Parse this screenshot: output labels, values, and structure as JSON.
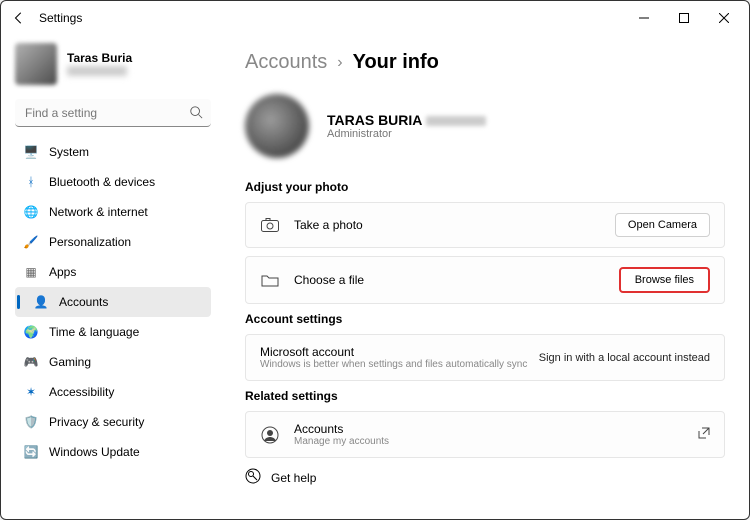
{
  "window": {
    "title": "Settings"
  },
  "user": {
    "name": "Taras Buria"
  },
  "search": {
    "placeholder": "Find a setting"
  },
  "nav": {
    "items": [
      {
        "label": "System",
        "color": "#0067c0",
        "glyph": "🖥️"
      },
      {
        "label": "Bluetooth & devices",
        "color": "#0067c0",
        "glyph": "ᚼ"
      },
      {
        "label": "Network & internet",
        "color": "#0099bc",
        "glyph": "🌐"
      },
      {
        "label": "Personalization",
        "color": "#c15c2e",
        "glyph": "🖌️"
      },
      {
        "label": "Apps",
        "color": "#666",
        "glyph": "▦"
      },
      {
        "label": "Accounts",
        "color": "#2a9d8f",
        "glyph": "👤"
      },
      {
        "label": "Time & language",
        "color": "#0078d4",
        "glyph": "🌍"
      },
      {
        "label": "Gaming",
        "color": "#107c10",
        "glyph": "🎮"
      },
      {
        "label": "Accessibility",
        "color": "#0067c0",
        "glyph": "✶"
      },
      {
        "label": "Privacy & security",
        "color": "#555",
        "glyph": "🛡️"
      },
      {
        "label": "Windows Update",
        "color": "#0078d4",
        "glyph": "🔄"
      }
    ],
    "active_index": 5
  },
  "breadcrumb": {
    "parent": "Accounts",
    "current": "Your info"
  },
  "profile": {
    "name": "TARAS BURIA",
    "role": "Administrator"
  },
  "sections": {
    "photo": {
      "title": "Adjust your photo",
      "take_photo": {
        "label": "Take a photo",
        "action": "Open Camera"
      },
      "choose_file": {
        "label": "Choose a file",
        "action": "Browse files"
      }
    },
    "account": {
      "title": "Account settings",
      "ms": {
        "label": "Microsoft account",
        "desc": "Windows is better when settings and files automatically sync",
        "action": "Sign in with a local account instead"
      }
    },
    "related": {
      "title": "Related settings",
      "accounts": {
        "label": "Accounts",
        "desc": "Manage my accounts"
      }
    },
    "help": {
      "label": "Get help"
    }
  }
}
